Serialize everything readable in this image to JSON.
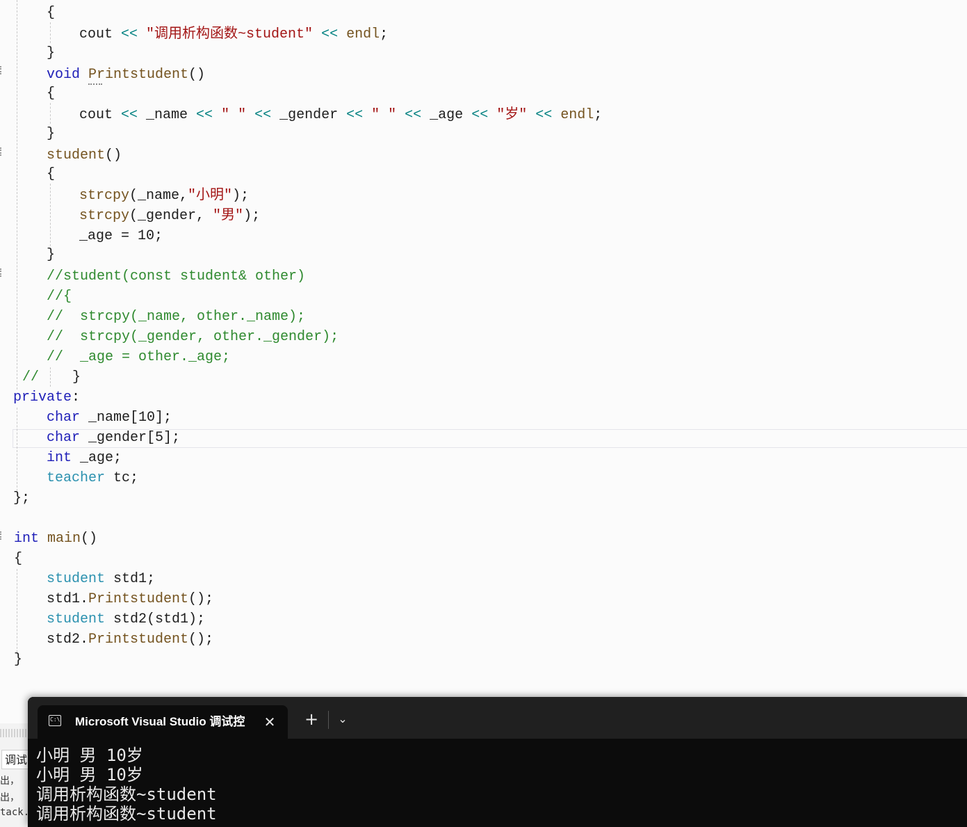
{
  "editor": {
    "lines": [
      [
        [
          "tx",
          "{"
        ]
      ],
      [
        [
          "tx",
          "cout "
        ],
        [
          "op",
          "<<"
        ],
        [
          "str",
          " \"调用析构函数~student\" "
        ],
        [
          "op",
          "<<"
        ],
        [
          "fn",
          " endl"
        ],
        [
          "tx",
          ";"
        ]
      ],
      [
        [
          "tx",
          "}"
        ]
      ],
      [
        [
          "kw",
          "void "
        ],
        [
          "fn",
          "Printstudent"
        ],
        [
          "tx",
          "()"
        ]
      ],
      [
        [
          "tx",
          "{"
        ]
      ],
      [
        [
          "tx",
          "cout "
        ],
        [
          "op",
          "<<"
        ],
        [
          "tx",
          " _name "
        ],
        [
          "op",
          "<<"
        ],
        [
          "str",
          " \" \" "
        ],
        [
          "op",
          "<<"
        ],
        [
          "tx",
          " _gender "
        ],
        [
          "op",
          "<<"
        ],
        [
          "str",
          " \" \" "
        ],
        [
          "op",
          "<<"
        ],
        [
          "tx",
          " _age "
        ],
        [
          "op",
          "<<"
        ],
        [
          "str",
          " \"岁\" "
        ],
        [
          "op",
          "<<"
        ],
        [
          "fn",
          " endl"
        ],
        [
          "tx",
          ";"
        ]
      ],
      [
        [
          "tx",
          "}"
        ]
      ],
      [
        [
          "fn",
          "student"
        ],
        [
          "tx",
          "()"
        ]
      ],
      [
        [
          "tx",
          "{"
        ]
      ],
      [
        [
          "fn",
          "strcpy"
        ],
        [
          "tx",
          "(_name,"
        ],
        [
          "str",
          "\"小明\""
        ],
        [
          "tx",
          ");"
        ]
      ],
      [
        [
          "fn",
          "strcpy"
        ],
        [
          "tx",
          "(_gender, "
        ],
        [
          "str",
          "\"男\""
        ],
        [
          "tx",
          ");"
        ]
      ],
      [
        [
          "tx",
          "_age = 10;"
        ]
      ],
      [
        [
          "tx",
          "}"
        ]
      ],
      [
        [
          "cm",
          "//student(const student& other)"
        ]
      ],
      [
        [
          "cm",
          "//{"
        ]
      ],
      [
        [
          "cm",
          "//  strcpy(_name, other._name);"
        ]
      ],
      [
        [
          "cm",
          "//  strcpy(_gender, other._gender);"
        ]
      ],
      [
        [
          "cm",
          "//  _age = other._age;"
        ]
      ],
      [
        [
          "cm",
          "//"
        ],
        [
          "tx",
          "    }"
        ]
      ],
      [
        [
          "kw",
          "private"
        ],
        [
          "tx",
          ":"
        ]
      ],
      [
        [
          "kw",
          "char "
        ],
        [
          "tx",
          "_name[10];"
        ]
      ],
      [
        [
          "kw",
          "char "
        ],
        [
          "tx",
          "_gender[5];"
        ]
      ],
      [
        [
          "kw",
          "int "
        ],
        [
          "tx",
          "_age;"
        ]
      ],
      [
        [
          "ty",
          "teacher "
        ],
        [
          "tx",
          "tc;"
        ]
      ],
      [
        [
          "tx",
          "};"
        ]
      ],
      [
        [
          "tx",
          ""
        ]
      ],
      [
        [
          "kw",
          "int "
        ],
        [
          "fn",
          "main"
        ],
        [
          "tx",
          "()"
        ]
      ],
      [
        [
          "tx",
          "{"
        ]
      ],
      [
        [
          "ty",
          "student "
        ],
        [
          "tx",
          "std1;"
        ]
      ],
      [
        [
          "tx",
          "std1."
        ],
        [
          "fn",
          "Printstudent"
        ],
        [
          "tx",
          "();"
        ]
      ],
      [
        [
          "ty",
          "student "
        ],
        [
          "tx",
          "std2(std1);"
        ]
      ],
      [
        [
          "tx",
          "std2."
        ],
        [
          "fn",
          "Printstudent"
        ],
        [
          "tx",
          "();"
        ]
      ],
      [
        [
          "tx",
          "}"
        ]
      ]
    ]
  },
  "background_panel": {
    "tab_label": "调试",
    "lines": [
      "出，",
      "出，",
      "tack."
    ]
  },
  "terminal": {
    "tab_title": "Microsoft Visual Studio 调试控",
    "close_glyph": "✕",
    "new_tab_glyph": "+",
    "dropdown_glyph": "⌄",
    "output": [
      "小明 男 10岁",
      "小明 男 10岁",
      "调用析构函数~student",
      "调用析构函数~student"
    ]
  }
}
